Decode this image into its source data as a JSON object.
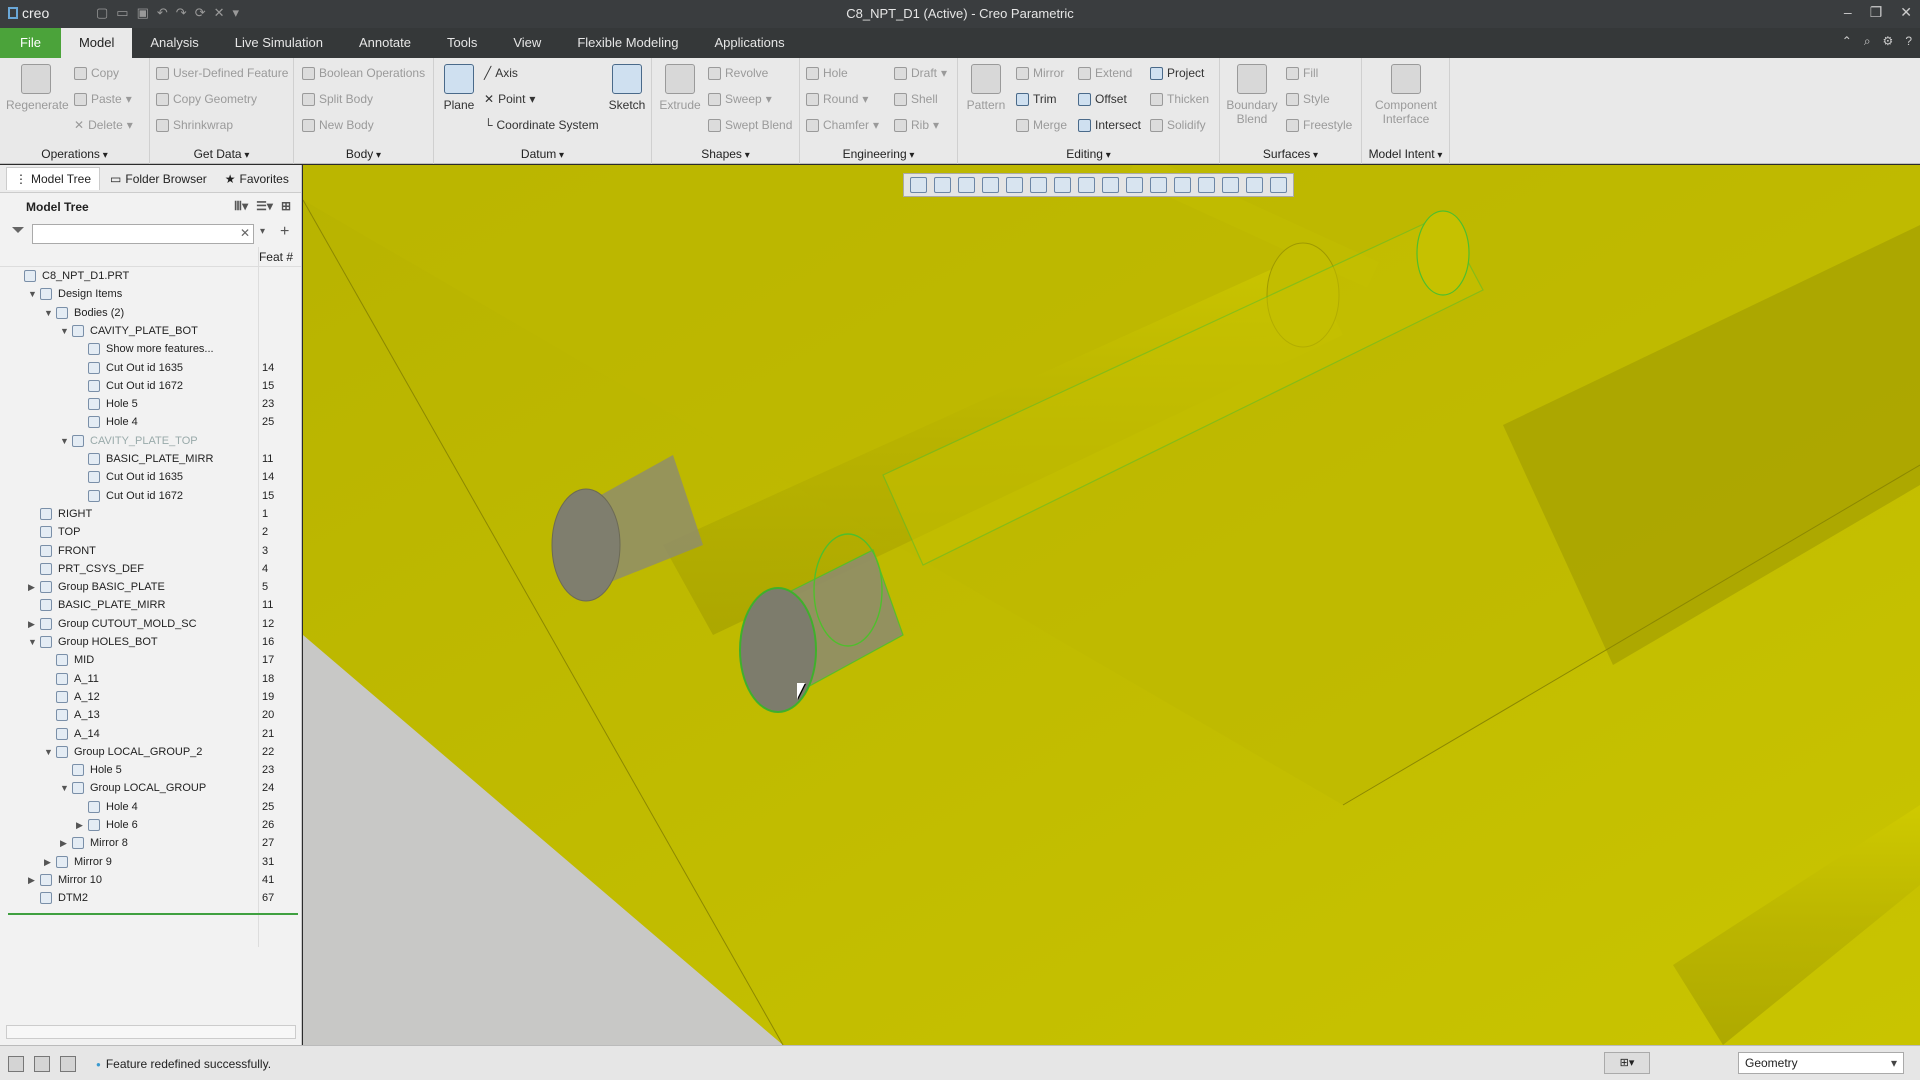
{
  "titlebar": {
    "logo": "creo",
    "title": "C8_NPT_D1 (Active) - Creo Parametric",
    "window_controls": [
      "minimize-icon",
      "restore-icon",
      "close-icon"
    ]
  },
  "menu_tabs": [
    "File",
    "Model",
    "Analysis",
    "Live Simulation",
    "Annotate",
    "Tools",
    "View",
    "Flexible Modeling",
    "Applications"
  ],
  "active_tab": "Model",
  "ribbon": {
    "operations": {
      "label": "Operations",
      "regenerate": "Regenerate",
      "copy": "Copy",
      "paste": "Paste",
      "delete": "Delete"
    },
    "getdata": {
      "label": "Get Data",
      "udf": "User-Defined Feature",
      "copy_geometry": "Copy Geometry",
      "shrinkwrap": "Shrinkwrap"
    },
    "body": {
      "label": "Body",
      "boolean": "Boolean Operations",
      "split": "Split Body",
      "new": "New Body"
    },
    "datum": {
      "label": "Datum",
      "plane": "Plane",
      "axis": "Axis",
      "point": "Point",
      "csys": "Coordinate System",
      "sketch": "Sketch"
    },
    "shapes": {
      "label": "Shapes",
      "extrude": "Extrude",
      "revolve": "Revolve",
      "sweep": "Sweep",
      "swept_blend": "Swept Blend"
    },
    "engineering": {
      "label": "Engineering",
      "hole": "Hole",
      "round": "Round",
      "chamfer": "Chamfer",
      "draft": "Draft",
      "shell": "Shell",
      "rib": "Rib"
    },
    "editing": {
      "label": "Editing",
      "pattern": "Pattern",
      "mirror": "Mirror",
      "trim": "Trim",
      "merge": "Merge",
      "extend": "Extend",
      "offset": "Offset",
      "intersect": "Intersect",
      "project": "Project",
      "thicken": "Thicken",
      "solidify": "Solidify"
    },
    "surfaces": {
      "label": "Surfaces",
      "boundary_blend": "Boundary Blend",
      "fill": "Fill",
      "style": "Style",
      "freestyle": "Freestyle"
    },
    "model_intent": {
      "label": "Model Intent",
      "component_interface": "Component Interface"
    }
  },
  "nav": {
    "model_tree": "Model Tree",
    "folder_browser": "Folder Browser",
    "favorites": "Favorites"
  },
  "tree_header": "Model Tree",
  "feat_col": "Feat #",
  "search": {
    "value": "",
    "placeholder": ""
  },
  "tree": [
    {
      "label": "C8_NPT_D1.PRT",
      "num": "",
      "level": 0,
      "toggle": ""
    },
    {
      "label": "Design Items",
      "num": "",
      "level": 1,
      "toggle": "open"
    },
    {
      "label": "Bodies (2)",
      "num": "",
      "level": 2,
      "toggle": "open"
    },
    {
      "label": "CAVITY_PLATE_BOT",
      "num": "",
      "level": 3,
      "toggle": "open"
    },
    {
      "label": "Show more features...",
      "num": "",
      "level": 4,
      "toggle": ""
    },
    {
      "label": "Cut Out id 1635",
      "num": "14",
      "level": 4,
      "toggle": ""
    },
    {
      "label": "Cut Out id 1672",
      "num": "15",
      "level": 4,
      "toggle": ""
    },
    {
      "label": "Hole 5",
      "num": "23",
      "level": 4,
      "toggle": ""
    },
    {
      "label": "Hole 4",
      "num": "25",
      "level": 4,
      "toggle": ""
    },
    {
      "label": "CAVITY_PLATE_TOP",
      "num": "",
      "level": 3,
      "toggle": "open",
      "sup": true
    },
    {
      "label": "BASIC_PLATE_MIRR",
      "num": "11",
      "level": 4,
      "toggle": ""
    },
    {
      "label": "Cut Out id 1635",
      "num": "14",
      "level": 4,
      "toggle": ""
    },
    {
      "label": "Cut Out id 1672",
      "num": "15",
      "level": 4,
      "toggle": ""
    },
    {
      "label": "RIGHT",
      "num": "1",
      "level": 1,
      "toggle": ""
    },
    {
      "label": "TOP",
      "num": "2",
      "level": 1,
      "toggle": ""
    },
    {
      "label": "FRONT",
      "num": "3",
      "level": 1,
      "toggle": ""
    },
    {
      "label": "PRT_CSYS_DEF",
      "num": "4",
      "level": 1,
      "toggle": ""
    },
    {
      "label": "Group BASIC_PLATE",
      "num": "5",
      "level": 1,
      "toggle": "closed"
    },
    {
      "label": "BASIC_PLATE_MIRR",
      "num": "11",
      "level": 1,
      "toggle": ""
    },
    {
      "label": "Group CUTOUT_MOLD_SC",
      "num": "12",
      "level": 1,
      "toggle": "closed"
    },
    {
      "label": "Group HOLES_BOT",
      "num": "16",
      "level": 1,
      "toggle": "open"
    },
    {
      "label": "MID",
      "num": "17",
      "level": 2,
      "toggle": ""
    },
    {
      "label": "A_11",
      "num": "18",
      "level": 2,
      "toggle": ""
    },
    {
      "label": "A_12",
      "num": "19",
      "level": 2,
      "toggle": ""
    },
    {
      "label": "A_13",
      "num": "20",
      "level": 2,
      "toggle": ""
    },
    {
      "label": "A_14",
      "num": "21",
      "level": 2,
      "toggle": ""
    },
    {
      "label": "Group LOCAL_GROUP_2",
      "num": "22",
      "level": 2,
      "toggle": "open"
    },
    {
      "label": "Hole 5",
      "num": "23",
      "level": 3,
      "toggle": ""
    },
    {
      "label": "Group LOCAL_GROUP",
      "num": "24",
      "level": 3,
      "toggle": "open"
    },
    {
      "label": "Hole 4",
      "num": "25",
      "level": 4,
      "toggle": ""
    },
    {
      "label": "Hole 6",
      "num": "26",
      "level": 4,
      "toggle": "closed"
    },
    {
      "label": "Mirror 8",
      "num": "27",
      "level": 3,
      "toggle": "closed"
    },
    {
      "label": "Mirror 9",
      "num": "31",
      "level": 2,
      "toggle": "closed"
    },
    {
      "label": "Mirror 10",
      "num": "41",
      "level": 1,
      "toggle": "closed"
    },
    {
      "label": "DTM2",
      "num": "67",
      "level": 1,
      "toggle": ""
    }
  ],
  "status": {
    "message": "Feature redefined successfully.",
    "selection_filter": "Geometry"
  },
  "colors": {
    "model": "#c9c400",
    "accent": "#4ba33a",
    "selection": "#3fb02c"
  }
}
